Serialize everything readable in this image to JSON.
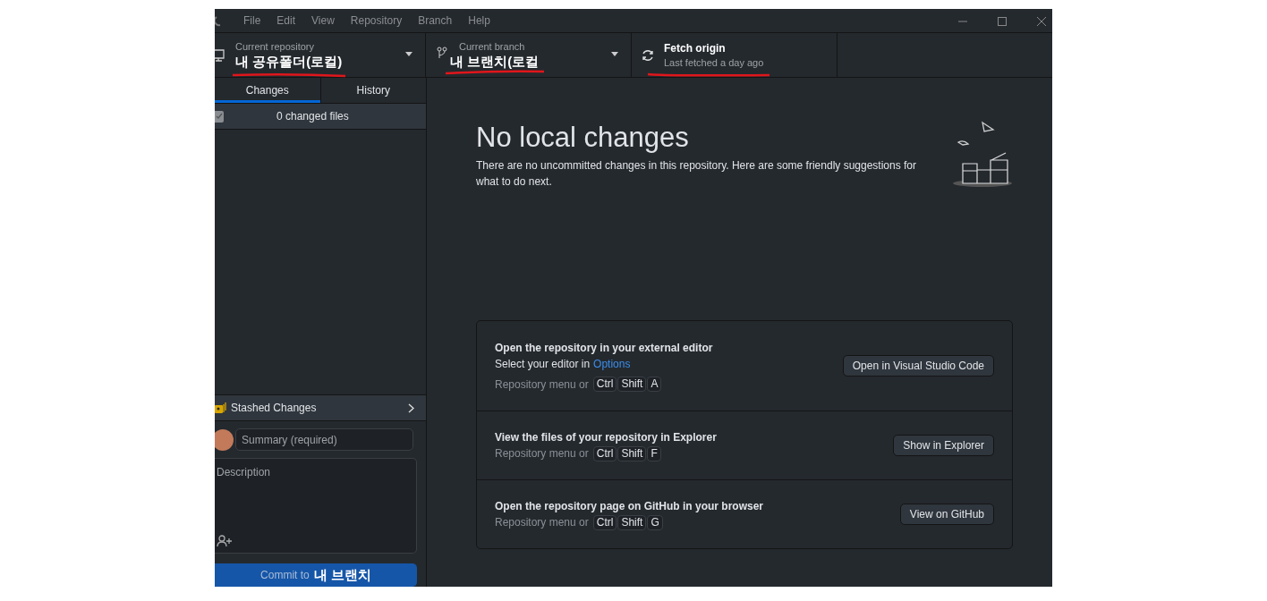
{
  "menu": [
    "File",
    "Edit",
    "View",
    "Repository",
    "Branch",
    "Help"
  ],
  "toolbar": {
    "repository": {
      "label": "Current repository",
      "value": "내 공유폴더(로컬)"
    },
    "branch": {
      "label": "Current branch",
      "value": "내 브랜치(로컬"
    },
    "fetch": {
      "title": "Fetch origin",
      "subtitle": "Last fetched a day ago"
    }
  },
  "tabs": [
    {
      "label": "Changes",
      "selected": true
    },
    {
      "label": "History",
      "selected": false
    }
  ],
  "changes": {
    "checked": true,
    "label": "0 changed files"
  },
  "stash": {
    "label": "Stashed Changes"
  },
  "commit": {
    "summary_placeholder": "Summary (required)",
    "description_placeholder": "Description",
    "button_prefix": "Commit to",
    "button_branch": "내 브랜치"
  },
  "main": {
    "title": "No local changes",
    "description": "There are no uncommitted changes in this repository. Here are some friendly suggestions for what to do next.",
    "suggestions": [
      {
        "title": "Open the repository in your external editor",
        "hint_prefix": "Select your editor in",
        "hint_link": "Options",
        "menu_text": "Repository menu or",
        "keys": [
          "Ctrl",
          "Shift",
          "A"
        ],
        "button": "Open in Visual Studio Code"
      },
      {
        "title": "View the files of your repository in Explorer",
        "menu_text": "Repository menu or",
        "keys": [
          "Ctrl",
          "Shift",
          "F"
        ],
        "button": "Show in Explorer"
      },
      {
        "title": "Open the repository page on GitHub in your browser",
        "menu_text": "Repository menu or",
        "keys": [
          "Ctrl",
          "Shift",
          "G"
        ],
        "button": "View on GitHub"
      }
    ]
  }
}
